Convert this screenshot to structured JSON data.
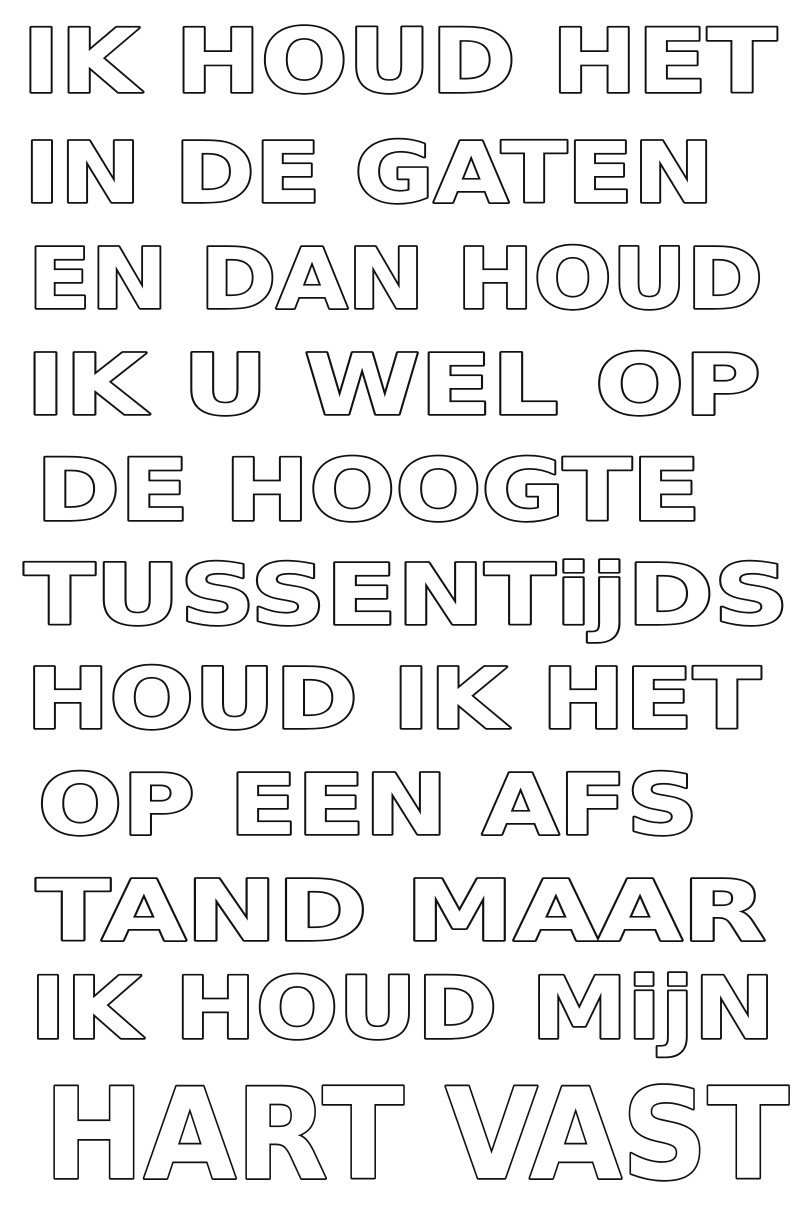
{
  "poem": {
    "lines": [
      "IK HOUD HET",
      "IN DE GATEN",
      "EN DAN HOUD",
      "IK U WEL OP",
      "DE HOOGTE",
      "TUSSENTijDS",
      "HOUD IK HET",
      "OP EEN AFS",
      "TAND MAAR",
      "IK HOUD MijN",
      "HART VAST"
    ]
  },
  "colors": {
    "ink": "#111111",
    "paper": "#ffffff"
  }
}
